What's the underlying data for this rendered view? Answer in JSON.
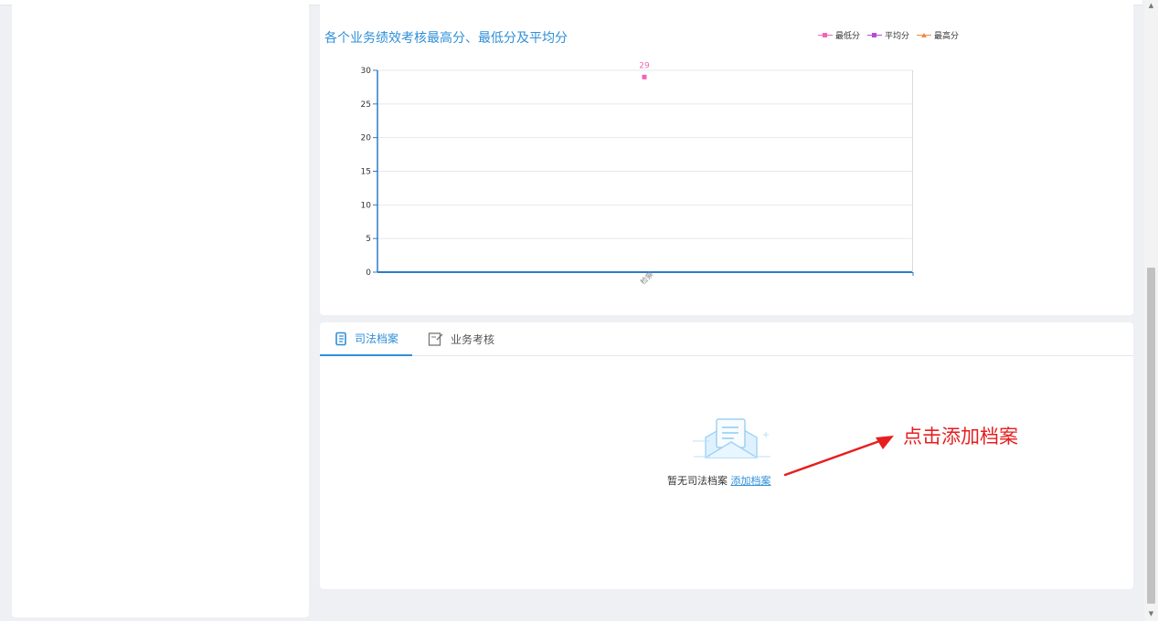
{
  "chart_card": {
    "title": "各个业务绩效考核最高分、最低分及平均分",
    "legend": [
      {
        "label": "最低分",
        "color": "#f065b6",
        "marker": "square"
      },
      {
        "label": "平均分",
        "color": "#b54bd8",
        "marker": "square"
      },
      {
        "label": "最高分",
        "color": "#f28b40",
        "marker": "triangle"
      }
    ]
  },
  "chart_data": {
    "type": "scatter",
    "title": "各个业务绩效考核最高分、最低分及平均分",
    "categories": [
      "检察"
    ],
    "ylim": [
      0,
      30
    ],
    "yticks": [
      0,
      5,
      10,
      15,
      20,
      25,
      30
    ],
    "series": [
      {
        "name": "最低分",
        "values": [
          29
        ],
        "color": "#f065b6"
      }
    ],
    "data_labels": [
      "29"
    ],
    "grid": "horizontal",
    "legend_position": "top-right"
  },
  "tabs": [
    {
      "label": "司法档案",
      "icon": "document-icon",
      "active": true
    },
    {
      "label": "业务考核",
      "icon": "edit-note-icon",
      "active": false
    }
  ],
  "empty_state": {
    "text": "暂无司法档案",
    "link": "添加档案",
    "icon": "envelope-empty-icon"
  },
  "annotation": {
    "text": "点击添加档案",
    "color": "#e61e1e"
  },
  "scrollbar": {
    "up": "▲",
    "down": "▼"
  }
}
